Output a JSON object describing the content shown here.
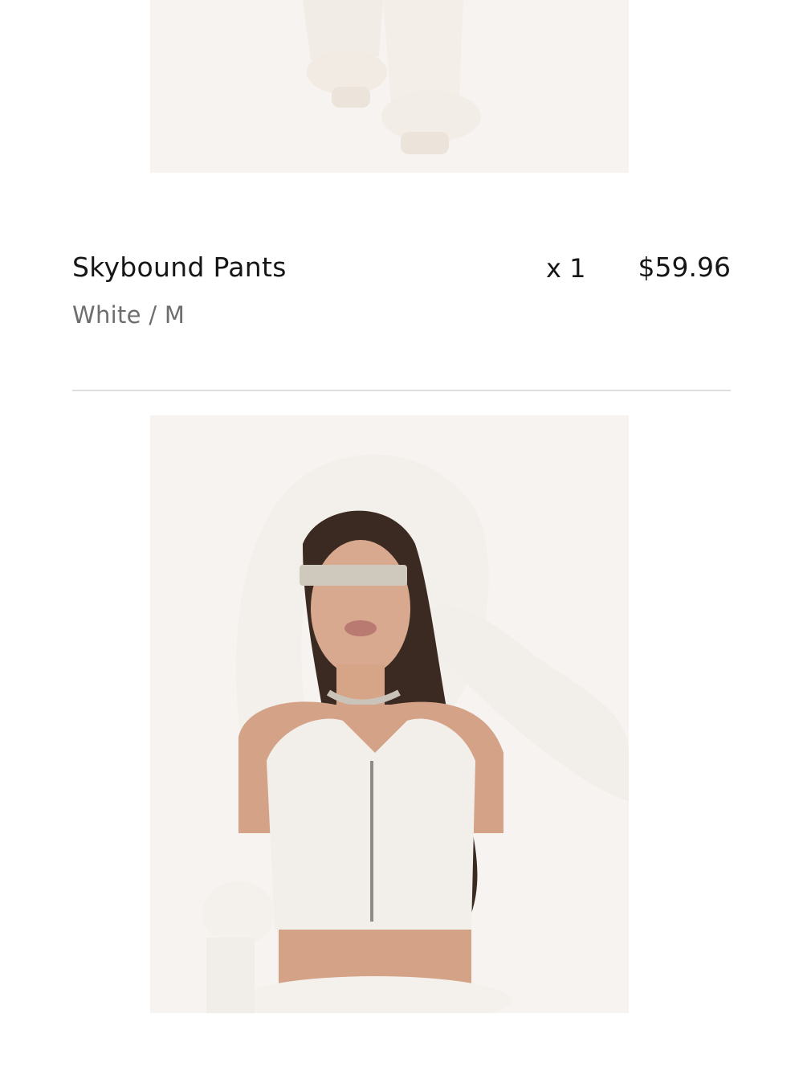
{
  "cart_items": [
    {
      "name": "Skybound Pants",
      "variant": "White / M",
      "quantity": "x 1",
      "price": "$59.96"
    }
  ]
}
